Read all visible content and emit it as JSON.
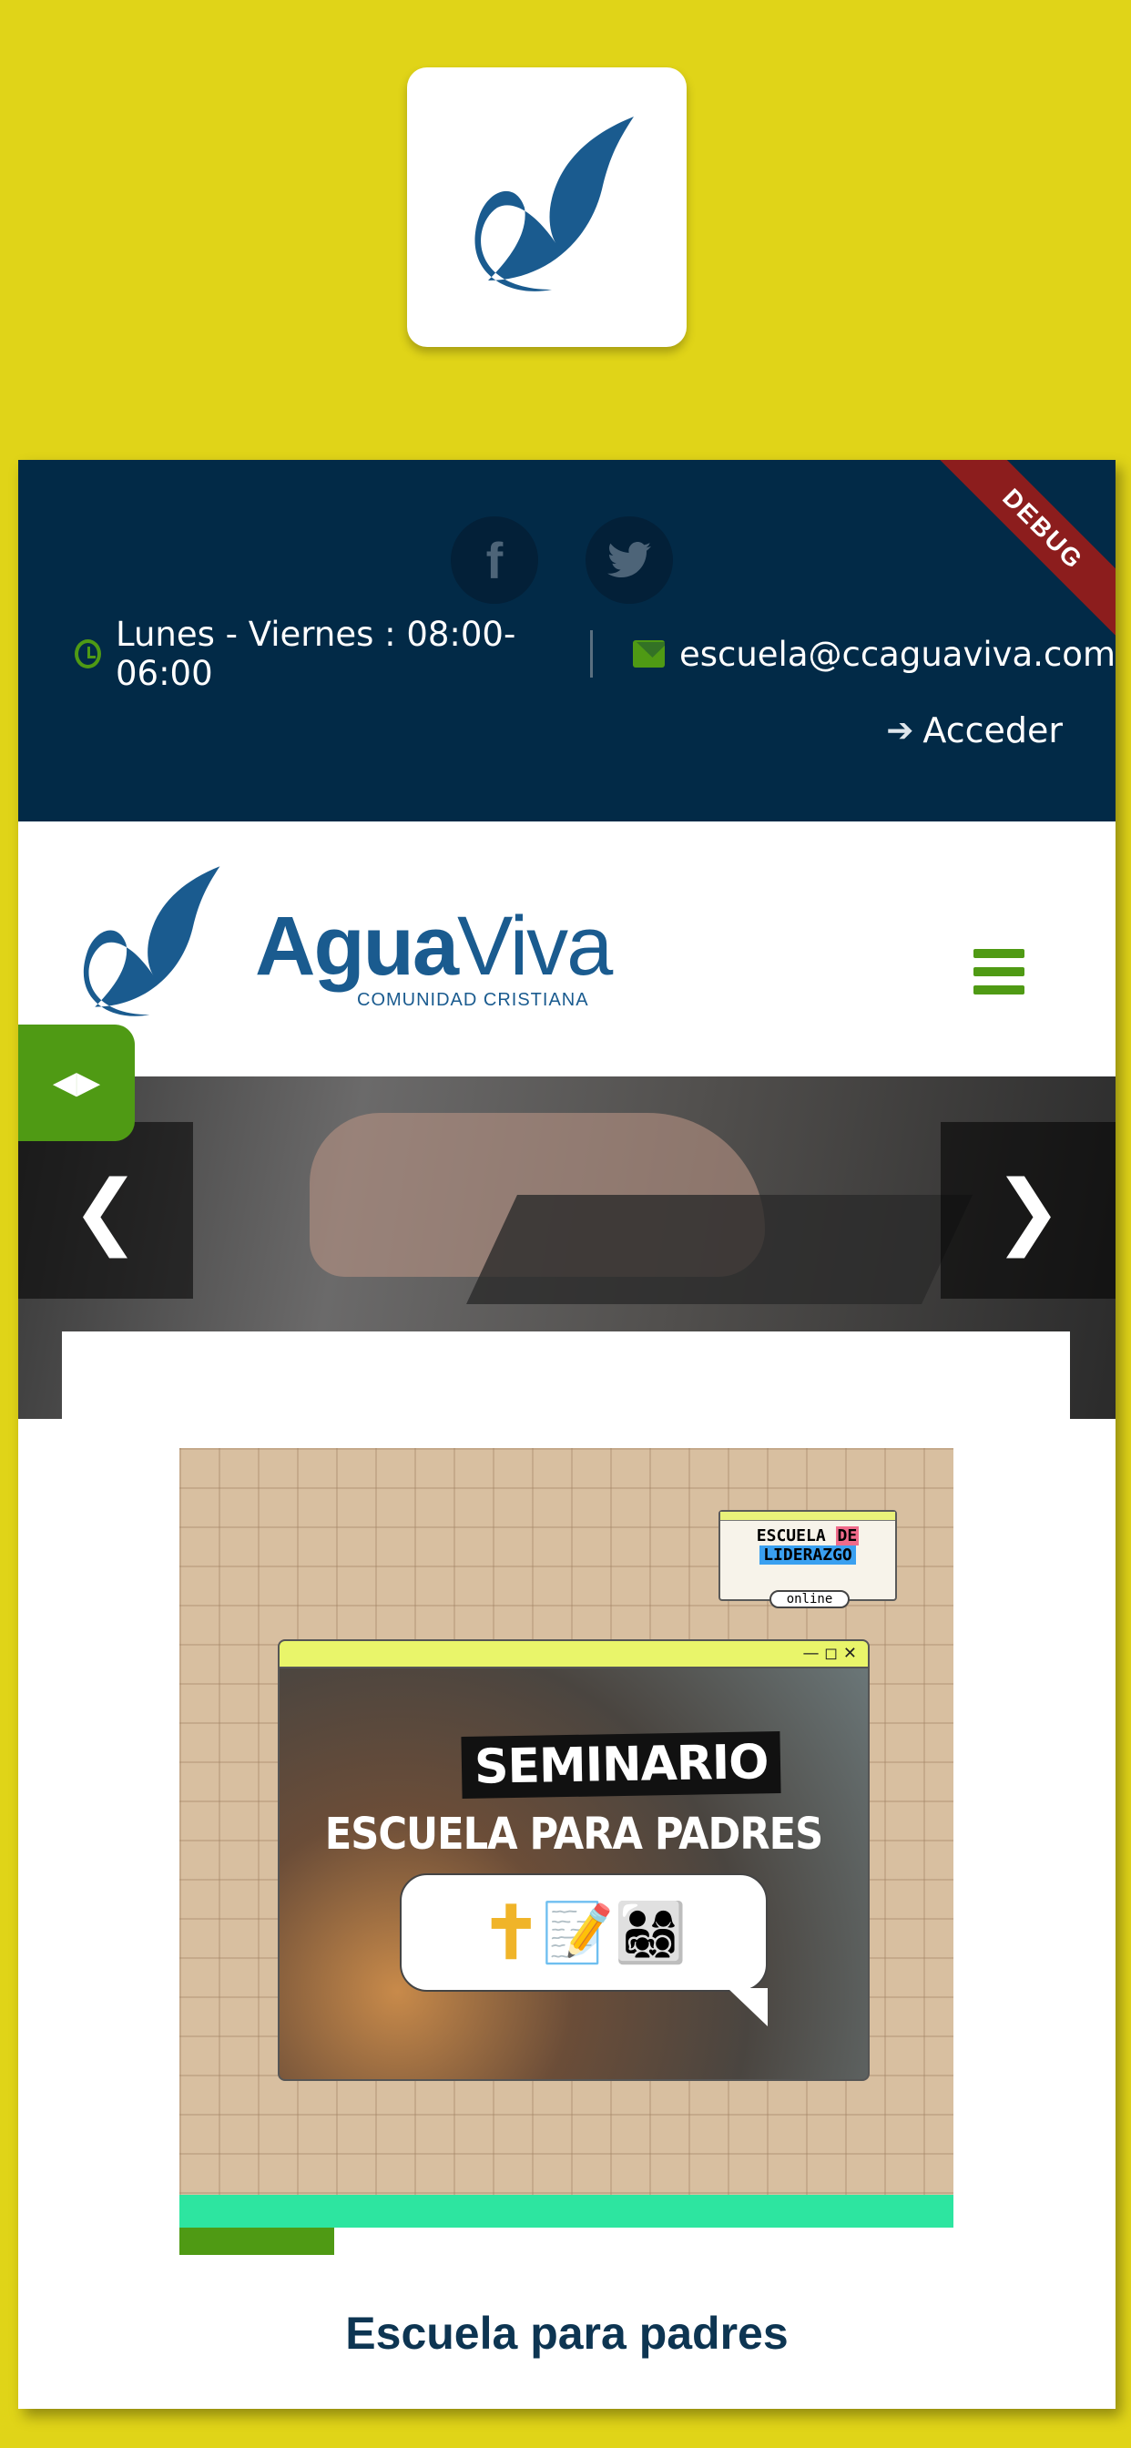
{
  "app_icon": {
    "name": "agua-viva-app-icon"
  },
  "topbar": {
    "hours": "Lunes - Viernes : 08:00-06:00",
    "email": "escuela@ccaguaviva.com",
    "login_label": "Acceder",
    "debug_label": "DEBUG"
  },
  "logo": {
    "name_part1": "Agua",
    "name_part2": "Viva",
    "subtitle": "COMUNIDAD CRISTIANA"
  },
  "poster": {
    "badge_line1a": "ESCUELA ",
    "badge_line1b": "DE",
    "badge_line2": "LIDERAZGO",
    "badge_online": "online",
    "window_controls": "— ◻ ✕",
    "title": "SEMINARIO",
    "subtitle": "ESCUELA PARA PADRES",
    "emojis": "📝👨‍👩‍👧‍👦"
  },
  "card": {
    "title": "Escuela para padres"
  },
  "colors": {
    "accent_green": "#4f9a14",
    "navy": "#022a47",
    "background_yellow": "#e0d418",
    "stripe_mint": "#2de5a0"
  }
}
